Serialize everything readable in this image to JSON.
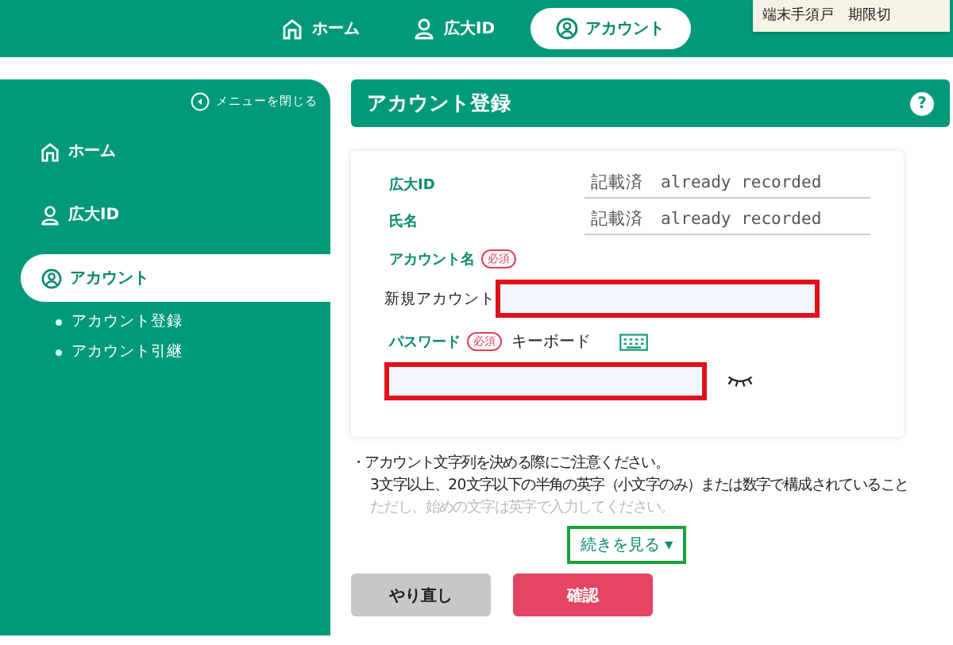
{
  "top_nav": {
    "items": [
      {
        "label": "ホーム",
        "kind": "home",
        "selected": false
      },
      {
        "label": "広大ID",
        "kind": "person",
        "selected": false
      },
      {
        "label": "アカウント",
        "kind": "account",
        "selected": true
      }
    ],
    "tooltip": "端末手須戸　期限切"
  },
  "sidebar": {
    "close_menu": "メニューを閉じる",
    "items": [
      {
        "label": "ホーム",
        "kind": "home",
        "selected": false
      },
      {
        "label": "広大ID",
        "kind": "person",
        "selected": false
      },
      {
        "label": "アカウント",
        "kind": "account",
        "selected": true,
        "children": [
          {
            "label": "アカウント登録"
          },
          {
            "label": "アカウント引継"
          }
        ]
      }
    ]
  },
  "panel": {
    "title": "アカウント登録",
    "help": "?"
  },
  "form": {
    "info_rows": [
      {
        "label": "広大ID",
        "value": "記載済　already recorded"
      },
      {
        "label": "氏名",
        "value": "記載済　already recorded"
      }
    ],
    "account": {
      "label": "アカウント名",
      "required": "必須",
      "field_label": "新規アカウント"
    },
    "password": {
      "label": "パスワード",
      "required": "必須",
      "keyboard": "キーボード",
      "visible": false
    }
  },
  "notes": [
    {
      "text": "・アカウント文字列を決める際にご注意ください。",
      "faded": false
    },
    {
      "text": "3文字以上、20文字以下の半角の英字（小文字のみ）または数字で構成されていること",
      "faded": false
    },
    {
      "text": "ただし、始めの文字は英字で入力してください。",
      "faded": true
    }
  ],
  "more_link": "続きを見る ▾",
  "buttons": [
    {
      "label": "やり直し",
      "kind": "secondary"
    },
    {
      "label": "確認",
      "kind": "primary"
    }
  ]
}
